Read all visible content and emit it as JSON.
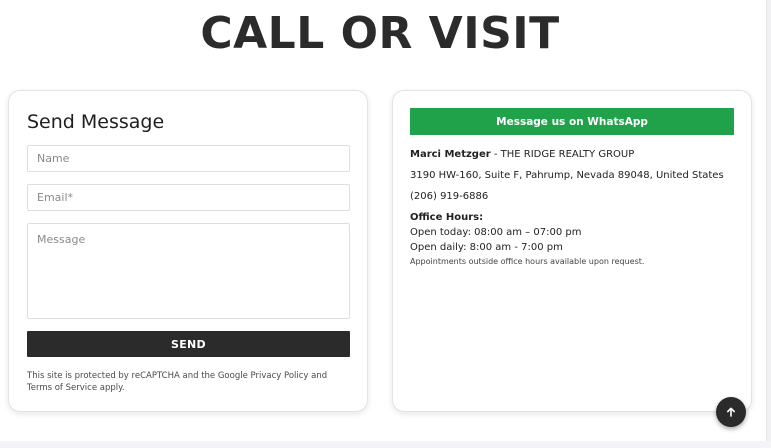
{
  "headline": "CALL OR VISIT",
  "form": {
    "title": "Send Message",
    "name_placeholder": "Name",
    "email_placeholder": "Email*",
    "message_placeholder": "Message",
    "send_label": "SEND",
    "recaptcha_note": "This site is protected by reCAPTCHA and the Google Privacy Policy and Terms of Service apply."
  },
  "contact": {
    "whatsapp_label": "Message us on WhatsApp",
    "agent_name": "Marci Metzger",
    "agent_separator": " - ",
    "company": "THE RIDGE REALTY GROUP",
    "address": "3190 HW-160, Suite F, Pahrump, Nevada 89048, United States",
    "phone": "(206) 919-6886",
    "hours_label": "Office Hours:",
    "hours_today": "Open today: 08:00 am – 07:00 pm",
    "hours_daily": "Open daily: 8:00 am - 7:00 pm",
    "hours_note": "Appointments outside office hours available upon request."
  },
  "colors": {
    "whatsapp_green": "#1fa24a",
    "dark": "#2b2b2b"
  },
  "icons": {
    "scroll_top": "arrow-up-icon"
  }
}
